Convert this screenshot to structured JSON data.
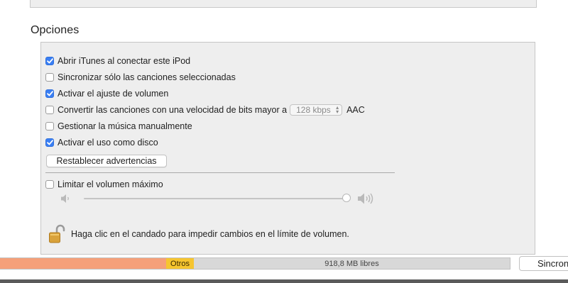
{
  "section": {
    "title": "Opciones"
  },
  "options": [
    {
      "label": "Abrir iTunes al conectar este iPod",
      "checked": true
    },
    {
      "label": "Sincronizar sólo las canciones seleccionadas",
      "checked": false
    },
    {
      "label": "Activar el ajuste de volumen",
      "checked": true
    },
    {
      "label": "Convertir las canciones con una velocidad de bits mayor a",
      "checked": false
    },
    {
      "label": "Gestionar la música manualmente",
      "checked": false
    },
    {
      "label": "Activar el uso como disco",
      "checked": true
    }
  ],
  "bitrate": {
    "value": "128 kbps",
    "format": "AAC"
  },
  "reset_button": {
    "label": "Restablecer advertencias"
  },
  "volume_limit": {
    "label": "Limitar el volumen máximo",
    "checked": false,
    "level": 1.0,
    "min_icon": "speaker-low-icon",
    "max_icon": "speaker-high-icon"
  },
  "lock": {
    "icon": "padlock-open-icon",
    "text": "Haga clic en el candado para impedir cambios en el límite de volumen."
  },
  "storage": {
    "other_label": "Otros",
    "free_label": "918,8 MB libres",
    "colors": {
      "audio": "#f5a07a",
      "other": "#f6c530",
      "free": "#d8d8d8"
    }
  },
  "sync_button": {
    "label": "Sincronizar"
  },
  "colors": {
    "accent": "#3a7ff3"
  }
}
